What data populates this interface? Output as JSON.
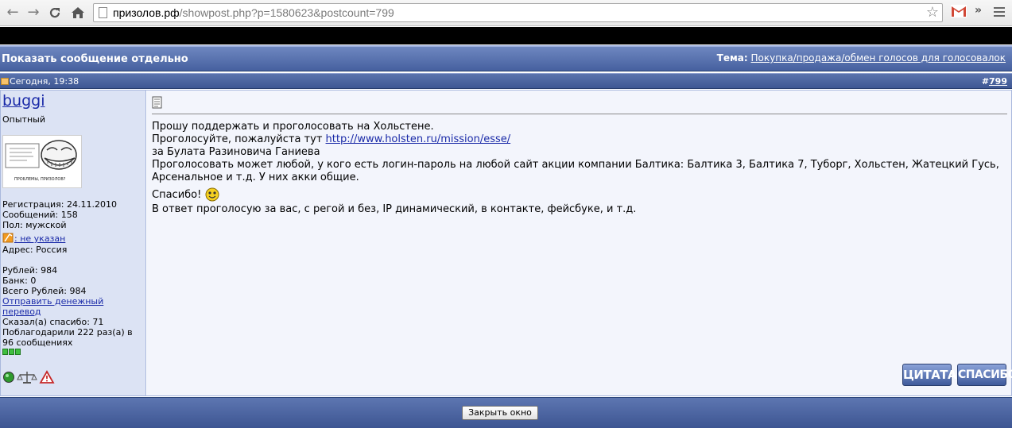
{
  "browser": {
    "url_domain": "призолов.рф",
    "url_rest": "/showpost.php?p=1580623&postcount=799"
  },
  "header": {
    "title": "Показать сообщение отдельно",
    "thread_label": "Тема:",
    "thread_link": "Покупка/продажа/обмен голосов для голосовалок"
  },
  "post": {
    "date": "Сегодня, 19:38",
    "number_prefix": "#",
    "number": "799"
  },
  "user": {
    "name": "buggi",
    "title": "Опытный",
    "avatar_caption": "ПРОБЛЕМЫ, ПРИЗОЛОВ?",
    "registration": "Регистрация: 24.11.2010",
    "messages": "Сообщений: 158",
    "gender": "Пол: мужской",
    "icq": ": не указан",
    "address": "Адрес: Россия",
    "rubles": "Рублей: 984",
    "bank": "Банк: 0",
    "total_rubles": "Всего Рублей: 984",
    "send_money_line1": "Отправить денежный",
    "send_money_line2": "перевод",
    "said_thanks": "Сказал(а) спасибо: 71",
    "thanked_line1": "Поблагодарили 222 раз(а) в",
    "thanked_line2": "96 сообщениях"
  },
  "message": {
    "line1": "Прошу поддержать и проголосовать на Хольстене.",
    "line2_text": "Проголосуйте, пожалуйста тут ",
    "line2_link": "http://www.holsten.ru/mission/esse/",
    "line3": "за Булата Разиновича Ганиева",
    "line4": "Проголосовать может любой, у кого есть логин-пароль на любой сайт акции компании Балтика: Балтика 3, Балтика 7, Туборг, Хольстен, Жатецкий Гусь,",
    "line5": "Арсенальное и т.д. У них акки общие.",
    "line6": "Спасибо!",
    "line7": "В ответ проголосую за вас, с регой и без, IP динамический, в контакте, фейсбуке, и т.д."
  },
  "buttons": {
    "quote": "ЦИТАТА",
    "thanks": "СПАСИБО",
    "close": "Закрыть окно"
  },
  "colors": {
    "header_blue": "#46609f",
    "user_pane": "#dce3f4",
    "content_bg": "#f3f5fc",
    "link": "#1a2aa8",
    "gmail_red": "#d14836"
  }
}
